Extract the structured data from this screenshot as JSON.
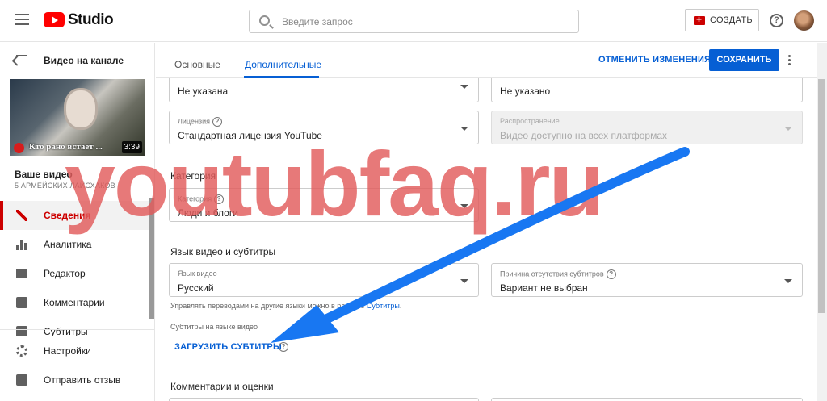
{
  "app": {
    "name": "Studio"
  },
  "search": {
    "placeholder": "Введите запрос"
  },
  "header": {
    "create_label": "СОЗДАТЬ",
    "help": "?"
  },
  "sidebar": {
    "back_label": "Видео на канале",
    "video_caption": "Кто рано встает ...",
    "video_duration": "3:39",
    "your_video_title": "Ваше видео",
    "channel_name": "5 АРМЕЙСКИХ ЛАЙСХАКОВ",
    "items": [
      {
        "label": "Сведения",
        "icon": "pencil-icon",
        "active": true
      },
      {
        "label": "Аналитика",
        "icon": "analytics-icon"
      },
      {
        "label": "Редактор",
        "icon": "editor-icon"
      },
      {
        "label": "Комментарии",
        "icon": "comments-icon"
      },
      {
        "label": "Субтитры",
        "icon": "subtitles-icon"
      },
      {
        "label": "Настройки",
        "icon": "gear-icon"
      },
      {
        "label": "Отправить отзыв",
        "icon": "feedback-icon"
      }
    ]
  },
  "tabs": [
    {
      "label": "Основные"
    },
    {
      "label": "Дополнительные",
      "active": true
    }
  ],
  "actions": {
    "undo_label": "ОТМЕНИТЬ ИЗМЕНЕНИЯ",
    "save_label": "СОХРАНИТЬ"
  },
  "fields": {
    "top_left_value": "Не указана",
    "top_right_value": "Не указано",
    "license_label": "Лицензия",
    "license_value": "Стандартная лицензия YouTube",
    "distribution_label": "Распространение",
    "distribution_value": "Видео доступно на всех платформах",
    "category_section": "Категория",
    "category_label": "Категория",
    "category_value": "Люди и блоги",
    "language_section": "Язык видео и субтитры",
    "video_language_label": "Язык видео",
    "video_language_value": "Русский",
    "no_subs_label": "Причина отсутствия субтитров",
    "no_subs_value": "Вариант не выбран",
    "translations_hint_prefix": "Управлять переводами на другие языки можно в разделе",
    "translations_hint_link": "Субтитры",
    "subtitles_language_hint": "Субтитры на языке видео",
    "upload_subtitles_label": "ЗАГРУЗИТЬ СУБТИТРЫ",
    "comments_section": "Комментарии и оценки"
  },
  "watermark": "youtubfaq.ru",
  "colors": {
    "accent": "#065fd4",
    "brand_red": "#cc0000",
    "arrow": "#1877f2"
  }
}
